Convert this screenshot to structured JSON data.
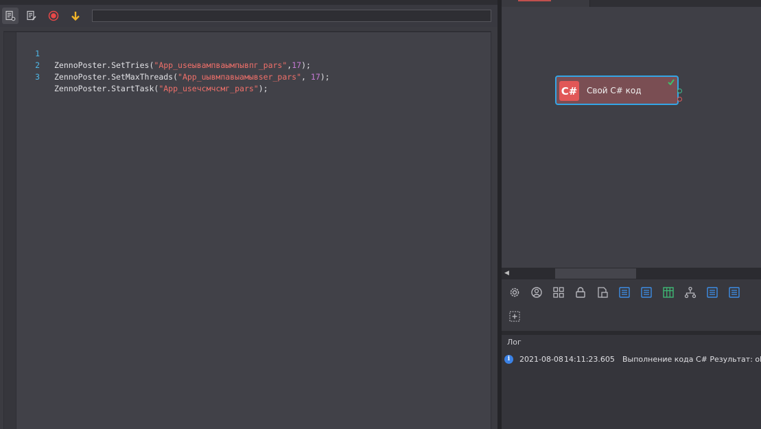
{
  "toolbar": {
    "buttons": [
      {
        "icon": "document-settings-icon"
      },
      {
        "icon": "document-edit-icon"
      },
      {
        "icon": "record-icon",
        "color": "#e84848"
      },
      {
        "icon": "arrow-down-icon",
        "color": "#f0b429"
      }
    ],
    "input_value": ""
  },
  "editor": {
    "lines": [
      {
        "num": "1",
        "pre": "ZennoPoster.SetTries(",
        "str": "\"App_useывампваымпывпг_pars\"",
        "mid": ",",
        "num_arg": "17",
        "post": ");"
      },
      {
        "num": "2",
        "pre": "ZennoPoster.SetMaxThreads(",
        "str": "\"App_uывмпавыамывser_pars\"",
        "mid": ", ",
        "num_arg": "17",
        "post": ");"
      },
      {
        "num": "3",
        "pre": "ZennoPoster.StartTask(",
        "str": "\"App_useчсмчсмг_pars\"",
        "mid": "",
        "num_arg": "",
        "post": ");"
      }
    ],
    "colors": {
      "string": "#f0706a",
      "number": "#c97bd6",
      "line_number": "#4fb7e6"
    }
  },
  "canvas": {
    "node": {
      "badge": "C#",
      "label": "Свой C# код",
      "status_icon": "checkmark-icon",
      "badge_color": "#e15757",
      "selected_border": "#34a6e6"
    }
  },
  "props_toolbar": {
    "icons": [
      "gear-icon",
      "user-circle-icon",
      "grid-icon",
      "lock-icon",
      "file-settings-icon",
      "list-icon",
      "list-icon",
      "table-icon",
      "hierarchy-icon",
      "list-icon",
      "list-icon",
      "add-block-icon"
    ]
  },
  "log": {
    "title": "Лог",
    "entries": [
      {
        "icon": "info-icon",
        "date": "2021-08-08",
        "time": "14:11:23.605",
        "message": "Выполнение кода C#  Результат: ok"
      }
    ]
  }
}
